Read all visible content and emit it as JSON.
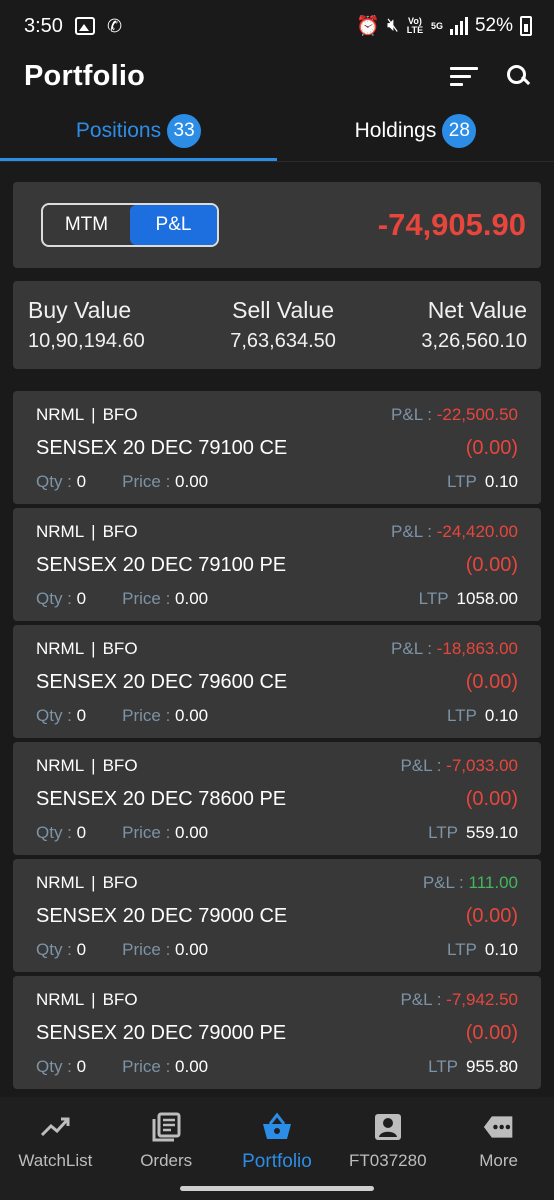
{
  "status_bar": {
    "time": "3:50",
    "battery": "52%",
    "network_label": "5G",
    "volte_label": "Vo) LTE"
  },
  "app_bar": {
    "title": "Portfolio"
  },
  "tabs": [
    {
      "label": "Positions",
      "count": "33"
    },
    {
      "label": "Holdings",
      "count": "28"
    }
  ],
  "pnl_card": {
    "mtm_label": "MTM",
    "pnl_label": "P&L",
    "total": "-74,905.90"
  },
  "values": {
    "buy_label": "Buy Value",
    "buy": "10,90,194.60",
    "sell_label": "Sell Value",
    "sell": "7,63,634.50",
    "net_label": "Net Value",
    "net": "3,26,560.10"
  },
  "labels": {
    "pnl": "P&L :",
    "qty": "Qty :",
    "price": "Price :",
    "ltp": "LTP"
  },
  "positions": [
    {
      "product": "NRML",
      "exchange": "BFO",
      "pnl": "-22,500.50",
      "symbol": "SENSEX 20 DEC 79100 CE",
      "change": "(0.00)",
      "qty": "0",
      "price": "0.00",
      "ltp": "0.10"
    },
    {
      "product": "NRML",
      "exchange": "BFO",
      "pnl": "-24,420.00",
      "symbol": "SENSEX 20 DEC 79100 PE",
      "change": "(0.00)",
      "qty": "0",
      "price": "0.00",
      "ltp": "1058.00"
    },
    {
      "product": "NRML",
      "exchange": "BFO",
      "pnl": "-18,863.00",
      "symbol": "SENSEX 20 DEC 79600 CE",
      "change": "(0.00)",
      "qty": "0",
      "price": "0.00",
      "ltp": "0.10"
    },
    {
      "product": "NRML",
      "exchange": "BFO",
      "pnl": "-7,033.00",
      "symbol": "SENSEX 20 DEC 78600 PE",
      "change": "(0.00)",
      "qty": "0",
      "price": "0.00",
      "ltp": "559.10"
    },
    {
      "product": "NRML",
      "exchange": "BFO",
      "pnl": "111.00",
      "symbol": "SENSEX 20 DEC 79000 CE",
      "change": "(0.00)",
      "qty": "0",
      "price": "0.00",
      "ltp": "0.10"
    },
    {
      "product": "NRML",
      "exchange": "BFO",
      "pnl": "-7,942.50",
      "symbol": "SENSEX 20 DEC 79000 PE",
      "change": "(0.00)",
      "qty": "0",
      "price": "0.00",
      "ltp": "955.80"
    }
  ],
  "bottom_nav": [
    {
      "label": "WatchList",
      "icon": "trending-up-icon"
    },
    {
      "label": "Orders",
      "icon": "orders-icon"
    },
    {
      "label": "Portfolio",
      "icon": "basket-icon"
    },
    {
      "label": "FT037280",
      "icon": "account-icon"
    },
    {
      "label": "More",
      "icon": "more-icon"
    }
  ],
  "colors": {
    "accent": "#2c8de6",
    "loss": "#e8463d",
    "profit": "#43b75c",
    "card": "#383838",
    "background": "#1a1a1a"
  }
}
